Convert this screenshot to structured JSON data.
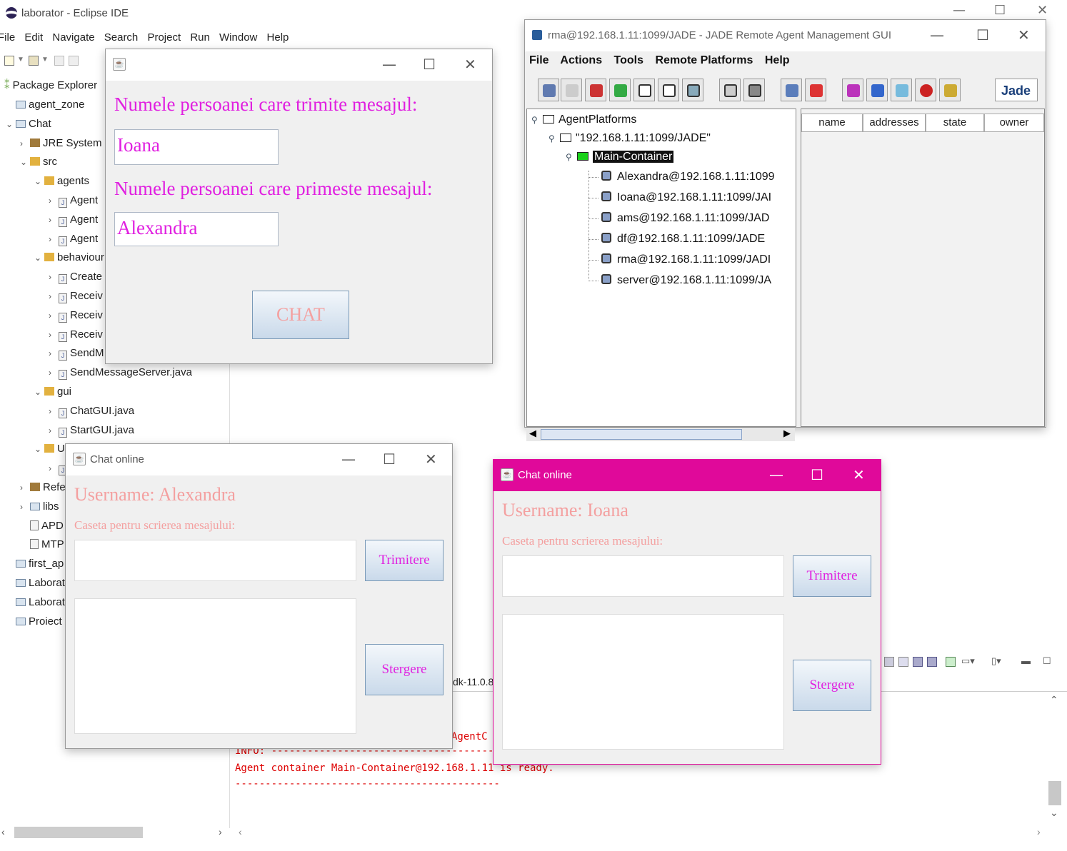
{
  "eclipse": {
    "title": "laborator - Eclipse IDE",
    "menu": [
      "File",
      "Edit",
      "Navigate",
      "Search",
      "Project",
      "Run",
      "Window",
      "Help"
    ],
    "package_explorer_label": "Package Explorer",
    "tree": [
      {
        "label": "agent_zone",
        "type": "folder",
        "indent": 0,
        "arrow": ""
      },
      {
        "label": "Chat",
        "type": "project",
        "indent": 0,
        "arrow": "⌄"
      },
      {
        "label": "JRE System L",
        "type": "lib",
        "indent": 1,
        "arrow": "›"
      },
      {
        "label": "src",
        "type": "pkg",
        "indent": 1,
        "arrow": "⌄"
      },
      {
        "label": "agents",
        "type": "pkg",
        "indent": 2,
        "arrow": "⌄"
      },
      {
        "label": "Agent",
        "type": "java",
        "indent": 3,
        "arrow": "›"
      },
      {
        "label": "Agent",
        "type": "java",
        "indent": 3,
        "arrow": "›"
      },
      {
        "label": "Agent",
        "type": "java",
        "indent": 3,
        "arrow": "›"
      },
      {
        "label": "behaviour",
        "type": "pkg",
        "indent": 2,
        "arrow": "⌄"
      },
      {
        "label": "Create",
        "type": "java",
        "indent": 3,
        "arrow": "›"
      },
      {
        "label": "Receiv",
        "type": "java",
        "indent": 3,
        "arrow": "›"
      },
      {
        "label": "Receiv",
        "type": "java",
        "indent": 3,
        "arrow": "›"
      },
      {
        "label": "Receiv",
        "type": "java",
        "indent": 3,
        "arrow": "›"
      },
      {
        "label": "SendM",
        "type": "java",
        "indent": 3,
        "arrow": "›"
      },
      {
        "label": "SendMessageServer.java",
        "type": "java",
        "indent": 3,
        "arrow": "›"
      },
      {
        "label": "gui",
        "type": "pkg",
        "indent": 2,
        "arrow": "⌄"
      },
      {
        "label": "ChatGUI.java",
        "type": "java",
        "indent": 3,
        "arrow": "›"
      },
      {
        "label": "StartGUI.java",
        "type": "java",
        "indent": 3,
        "arrow": "›"
      },
      {
        "label": "U",
        "type": "pkg",
        "indent": 2,
        "arrow": "⌄"
      },
      {
        "label": "",
        "type": "java",
        "indent": 3,
        "arrow": "›"
      },
      {
        "label": "Refe",
        "type": "lib",
        "indent": 1,
        "arrow": "›"
      },
      {
        "label": "libs",
        "type": "folder",
        "indent": 1,
        "arrow": "›"
      },
      {
        "label": "APD",
        "type": "file",
        "indent": 1,
        "arrow": ""
      },
      {
        "label": "MTP",
        "type": "file",
        "indent": 1,
        "arrow": ""
      },
      {
        "label": "first_ap",
        "type": "folder",
        "indent": 0,
        "arrow": ""
      },
      {
        "label": "Laborat",
        "type": "folder",
        "indent": 0,
        "arrow": ""
      },
      {
        "label": "Laborat",
        "type": "folder",
        "indent": 0,
        "arrow": ""
      },
      {
        "label": "Proiect",
        "type": "folder",
        "indent": 0,
        "arrow": ""
      }
    ],
    "console": {
      "fragment1": "dk-11.0.8",
      "fragment2": "AgentC",
      "lines": [
        "INFO: --------------------------------------------",
        "Agent container Main-Container@192.168.1.11 is ready.",
        "--------------------------------------------"
      ]
    }
  },
  "start_dialog": {
    "title": "",
    "sender_label": "Numele persoanei care trimite mesajul:",
    "sender_value": "Ioana",
    "receiver_label": "Numele persoanei care primeste mesajul:",
    "receiver_value": "Alexandra",
    "chat_button": "CHAT"
  },
  "jade": {
    "title": "rma@192.168.1.11:1099/JADE - JADE Remote Agent Management GUI",
    "menu": [
      "File",
      "Actions",
      "Tools",
      "Remote Platforms",
      "Help"
    ],
    "tree": {
      "root": "AgentPlatforms",
      "platform": "\"192.168.1.11:1099/JADE\"",
      "container": "Main-Container",
      "agents": [
        "Alexandra@192.168.1.11:1099",
        "Ioana@192.168.1.11:1099/JAI",
        "ams@192.168.1.11:1099/JAD",
        "df@192.168.1.11:1099/JADE",
        "rma@192.168.1.11:1099/JADI",
        "server@192.168.1.11:1099/JA"
      ]
    },
    "table_headers": [
      "name",
      "addresses",
      "state",
      "owner"
    ],
    "logo_text": "Jade"
  },
  "chat_alexandra": {
    "title": "Chat online",
    "username": "Username: Alexandra",
    "caption": "Caseta pentru scrierea mesajului:",
    "send_button": "Trimitere",
    "clear_button": "Stergere",
    "message_value": ""
  },
  "chat_ioana": {
    "title": "Chat online",
    "username": "Username: Ioana",
    "caption": "Caseta pentru scrierea mesajului:",
    "send_button": "Trimitere",
    "clear_button": "Stergere",
    "message_value": ""
  },
  "colors": {
    "magenta_label": "#e020e0",
    "pink_text": "#f4a0a0",
    "active_titlebar": "#e0099a",
    "console_red": "#dd0000"
  }
}
